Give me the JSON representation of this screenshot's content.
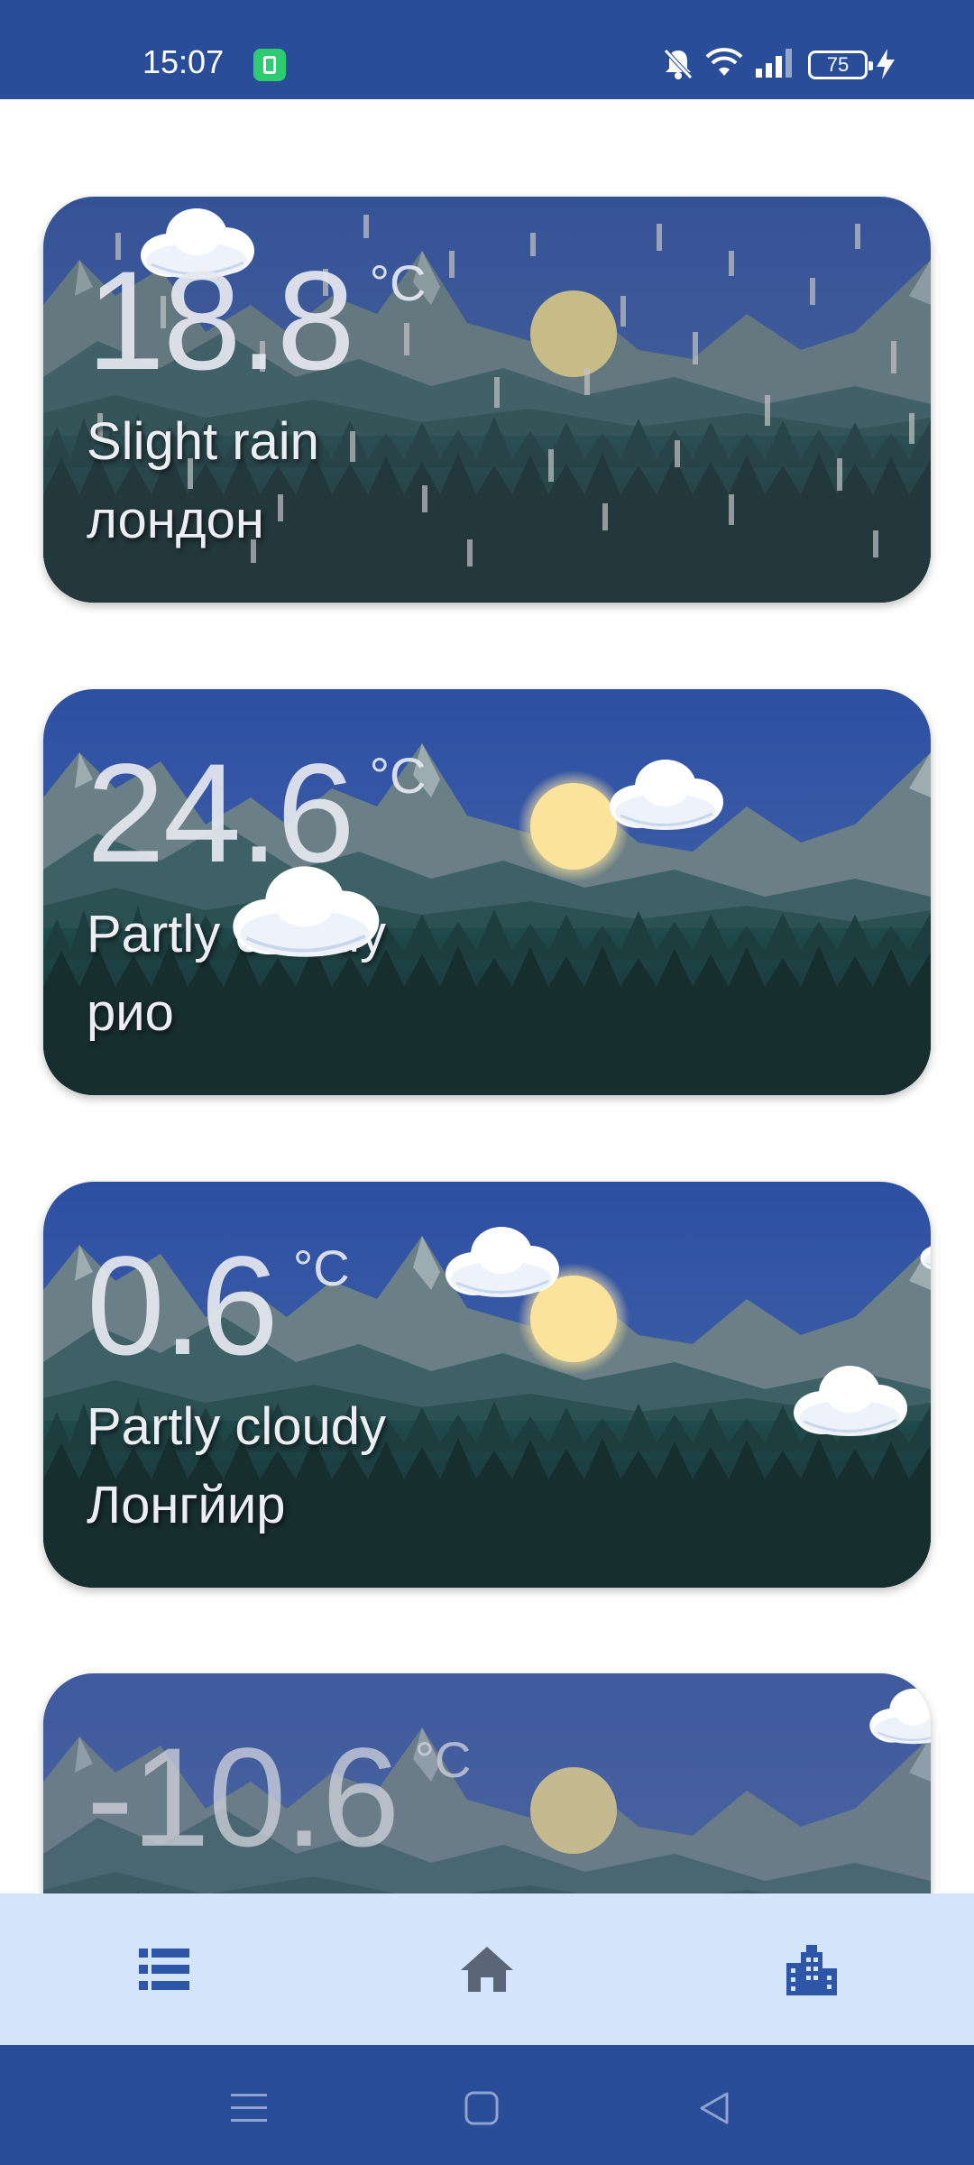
{
  "status_bar": {
    "time": "15:07",
    "battery_level": "75",
    "icons": [
      "battery-saver-icon",
      "mute-icon",
      "wifi-icon",
      "signal-icon",
      "battery-icon",
      "charging-icon"
    ]
  },
  "cards": [
    {
      "temp": "18.8",
      "unit": "°C",
      "condition": "Slight rain",
      "city": "лондон"
    },
    {
      "temp": "24.6",
      "unit": "°C",
      "condition": "Partly cloudy",
      "city": "рио"
    },
    {
      "temp": "0.6",
      "unit": "°C",
      "condition": "Partly cloudy",
      "city": "Лонгйир"
    },
    {
      "temp": "-10.6",
      "unit": "°C",
      "condition": "",
      "city": ""
    }
  ],
  "bottom_nav": {
    "items": [
      "list-icon",
      "home-icon",
      "city-icon"
    ],
    "active_color": "#2d55a8",
    "inactive_color": "#5a6578"
  },
  "system_nav": [
    "menu-icon",
    "home-square-icon",
    "back-icon"
  ],
  "colors": {
    "status_bar": "#294d99",
    "bottom_nav_bg": "#d4e4fa",
    "sun": "#fbe39c"
  }
}
